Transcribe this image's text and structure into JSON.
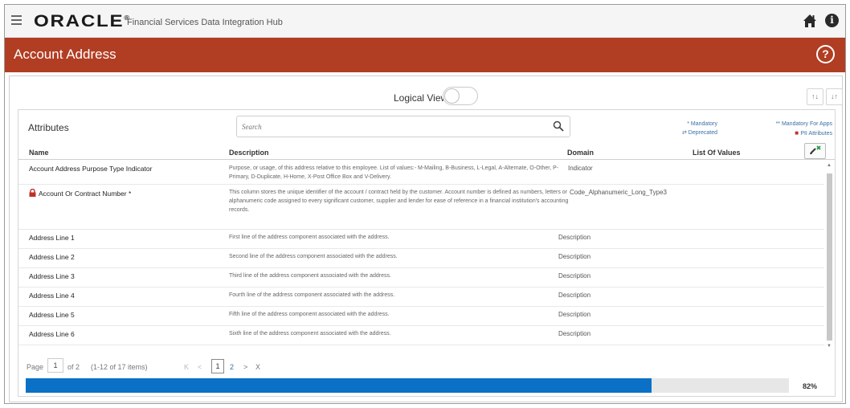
{
  "header": {
    "logo": "ORACLE",
    "product": "Financial Services Data Integration Hub",
    "home_icon": "home-icon",
    "info_icon": "info-icon"
  },
  "page": {
    "title": "Account Address",
    "help_icon": "help-icon"
  },
  "toolbar": {
    "logical_view_label": "Logical View",
    "logical_view_on": false
  },
  "attributes": {
    "label": "Attributes",
    "search_placeholder": "Search",
    "legend": {
      "mandatory": "* Mandatory",
      "deprecated": "Deprecated",
      "mandatory_apps": "** Mandatory For Apps",
      "pii": "PII Attributes"
    },
    "columns": [
      "Name",
      "Description",
      "Domain",
      "List Of Values"
    ],
    "rows": [
      {
        "name": "Account Address Purpose Type Indicator",
        "pii": false,
        "description": "Purpose, or usage, of this address relative to this employee. List of values:- M-Mailing, B-Business, L-Legal, A-Alternate, O-Other, P-Primary, D-Duplicate, H-Home, X-Post Office Box and V-Delivery.",
        "domain": "Indicator"
      },
      {
        "name": "Account Or Contract Number *",
        "pii": true,
        "description": "This column stores the unique identifier of the account / contract held by the customer. Account number is defined as numbers, letters or alphanumeric code assigned to every significant customer, supplier and lender for ease of reference in a financial institution's accounting records.",
        "domain": "Code_Alphanumeric_Long_Type3"
      },
      {
        "name": "Address Line 1",
        "pii": false,
        "description": "First line of the address component associated with the address.",
        "domain": "Description"
      },
      {
        "name": "Address Line 2",
        "pii": false,
        "description": "Second line of the address component associated with the address.",
        "domain": "Description"
      },
      {
        "name": "Address Line 3",
        "pii": false,
        "description": "Third line of the address component associated with the address.",
        "domain": "Description"
      },
      {
        "name": "Address Line 4",
        "pii": false,
        "description": "Fourth line of the address component associated with the address.",
        "domain": "Description"
      },
      {
        "name": "Address Line 5",
        "pii": false,
        "description": "Fifth line of the address component associated with the address.",
        "domain": "Description"
      },
      {
        "name": "Address Line 6",
        "pii": false,
        "description": "Sixth line of the address component associated with the address.",
        "domain": "Description"
      }
    ]
  },
  "pagination": {
    "page_label": "Page",
    "current_page": "1",
    "of_label": "of 2",
    "items_label": "(1-12 of 17 items)",
    "first": "K",
    "prev": "<",
    "pages": [
      "1",
      "2"
    ],
    "next": ">",
    "last": "X"
  },
  "progress": {
    "value": 0.82,
    "label": "82%",
    "color": "#0a71c7"
  },
  "colors": {
    "title_bar": "#b13d23",
    "pii_lock": "#c0302a",
    "link": "#3a6ea5"
  }
}
